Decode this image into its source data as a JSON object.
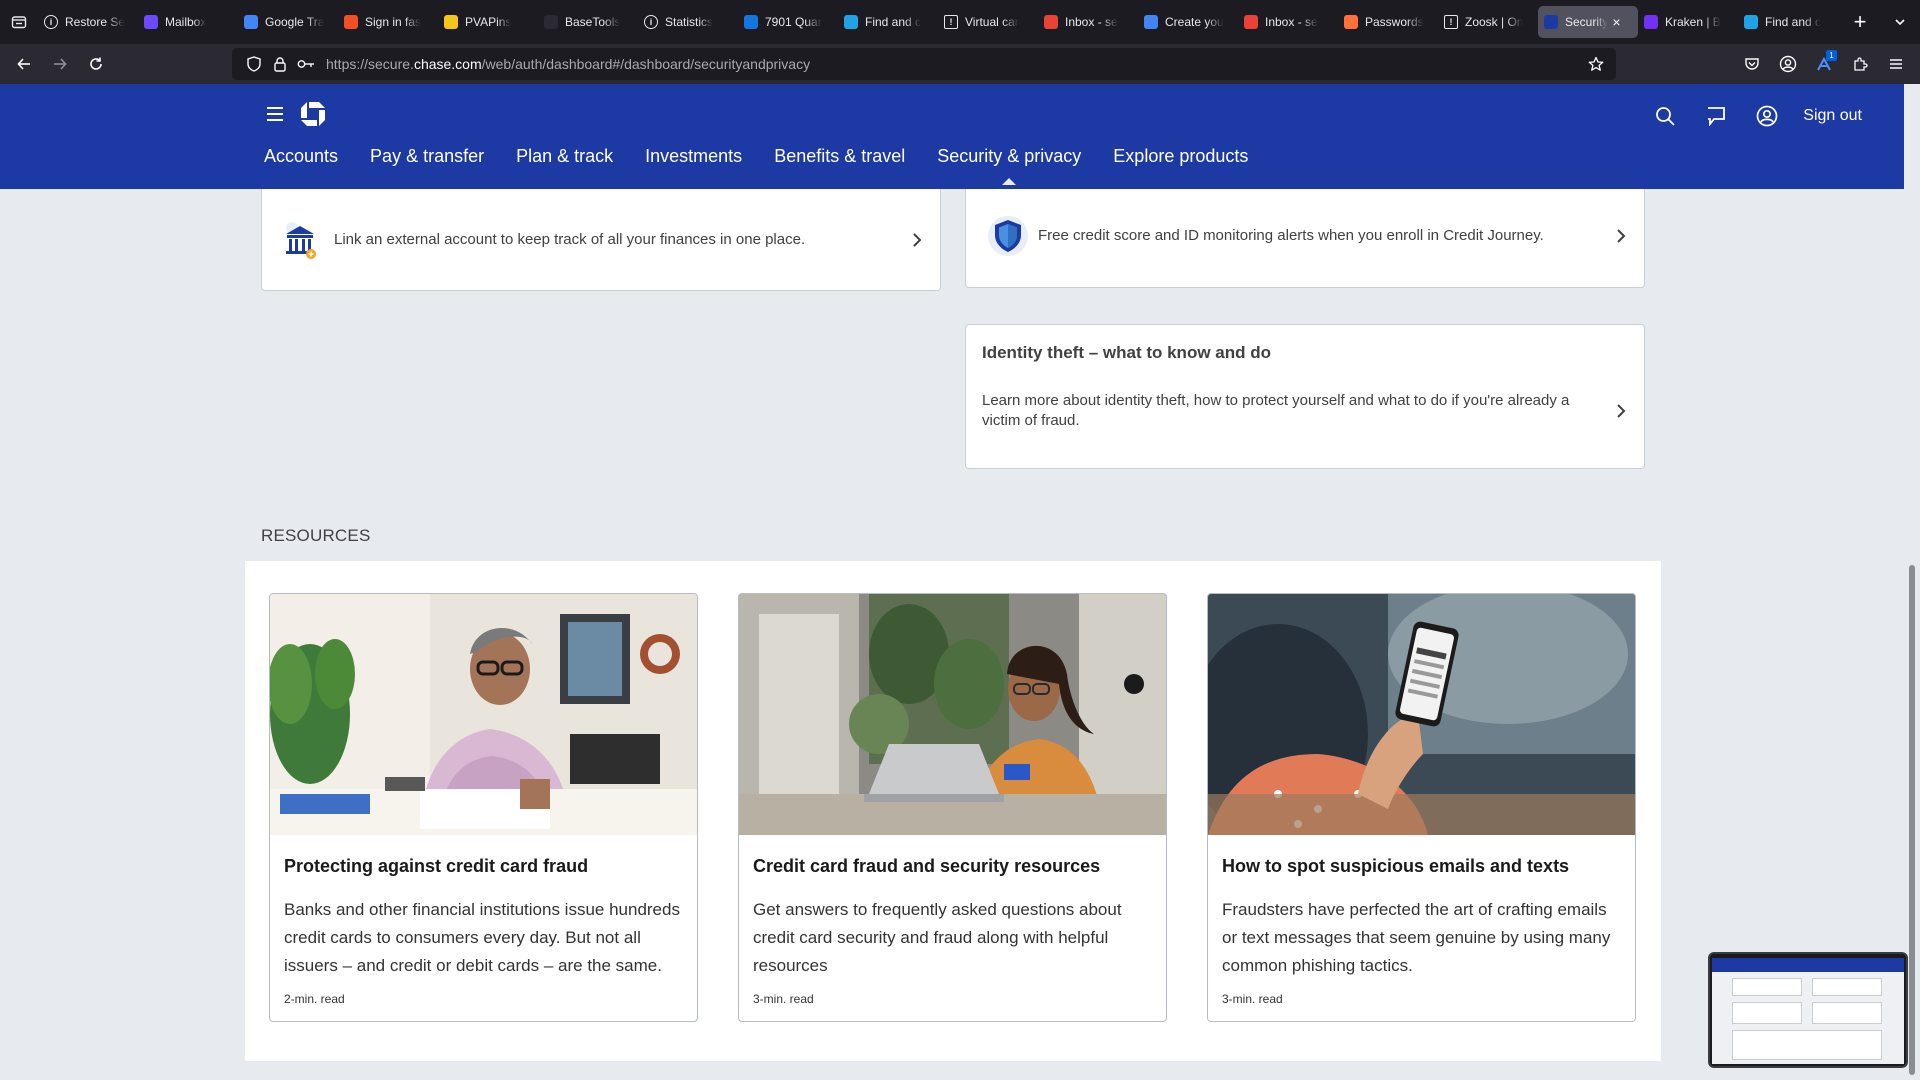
{
  "browser": {
    "tabs": [
      {
        "title": "Restore Se",
        "icon": "info-icon",
        "color": "#e8e8ea"
      },
      {
        "title": "Mailbox",
        "icon": "proton-mail-icon",
        "color": "#6d4aff"
      },
      {
        "title": "Google Tra",
        "icon": "google-translate-icon",
        "color": "#4285f4"
      },
      {
        "title": "Sign in fas",
        "icon": "microsoft-icon",
        "color": "#f25022"
      },
      {
        "title": "PVAPins",
        "icon": "pvapins-icon",
        "color": "#f5c518"
      },
      {
        "title": "BaseTools",
        "icon": "basetools-icon",
        "color": "#2b2a33"
      },
      {
        "title": "Statistics",
        "icon": "info-icon",
        "color": "#e8e8ea"
      },
      {
        "title": "7901 Quar",
        "icon": "zillow-icon",
        "color": "#1277e1"
      },
      {
        "title": "Find and c",
        "icon": "w-icon",
        "color": "#1fa3e6"
      },
      {
        "title": "Virtual car",
        "icon": "warning-icon",
        "color": "#e8e8ea"
      },
      {
        "title": "Inbox - se",
        "icon": "gmail-icon",
        "color": "#ea4335"
      },
      {
        "title": "Create you",
        "icon": "google-icon",
        "color": "#4285f4"
      },
      {
        "title": "Inbox - se",
        "icon": "gmail-icon",
        "color": "#ea4335"
      },
      {
        "title": "Passwords",
        "icon": "firefox-icon",
        "color": "#ff7139"
      },
      {
        "title": "Zoosk | On",
        "icon": "warning-icon",
        "color": "#e8e8ea"
      },
      {
        "title": "Security",
        "icon": "chase-icon",
        "color": "#1d39a4",
        "active": true
      },
      {
        "title": "Kraken | B",
        "icon": "kraken-icon",
        "color": "#7132f5"
      },
      {
        "title": "Find and c",
        "icon": "w-icon",
        "color": "#1fa3e6"
      }
    ],
    "url_prefix": "https://secure.",
    "url_domain": "chase.com",
    "url_suffix": "/web/auth/dashboard#/dashboard/securityandprivacy",
    "extension_badge": "1"
  },
  "header": {
    "signout_label": "Sign out",
    "nav": [
      "Accounts",
      "Pay & transfer",
      "Plan & track",
      "Investments",
      "Benefits & travel",
      "Security & privacy",
      "Explore products"
    ],
    "active_nav": "Security & privacy",
    "brand_color": "#1d39a4"
  },
  "cards": {
    "link_external": "Link an external account to keep track of all your finances in one place.",
    "credit_journey": "Free credit score and ID monitoring alerts when you enroll in Credit Journey.",
    "identity_title": "Identity theft – what to know and do",
    "identity_text": "Learn more about identity theft, how to protect yourself and what to do if you're already a victim of fraud."
  },
  "resources": {
    "heading": "RESOURCES",
    "items": [
      {
        "title": "Protecting against credit card fraud",
        "desc": "Banks and other financial institutions issue hundreds credit cards to consumers every day. But not all issuers – and credit or debit cards – are the same.",
        "meta": "2-min. read"
      },
      {
        "title": "Credit card fraud and security resources",
        "desc": "Get answers to frequently asked questions about credit card security and fraud along with helpful resources",
        "meta": "3-min. read"
      },
      {
        "title": "How to spot suspicious emails and texts",
        "desc": "Fraudsters have perfected the art of crafting emails or text messages that seem genuine by using many common phishing tactics.",
        "meta": "3-min. read"
      }
    ]
  }
}
